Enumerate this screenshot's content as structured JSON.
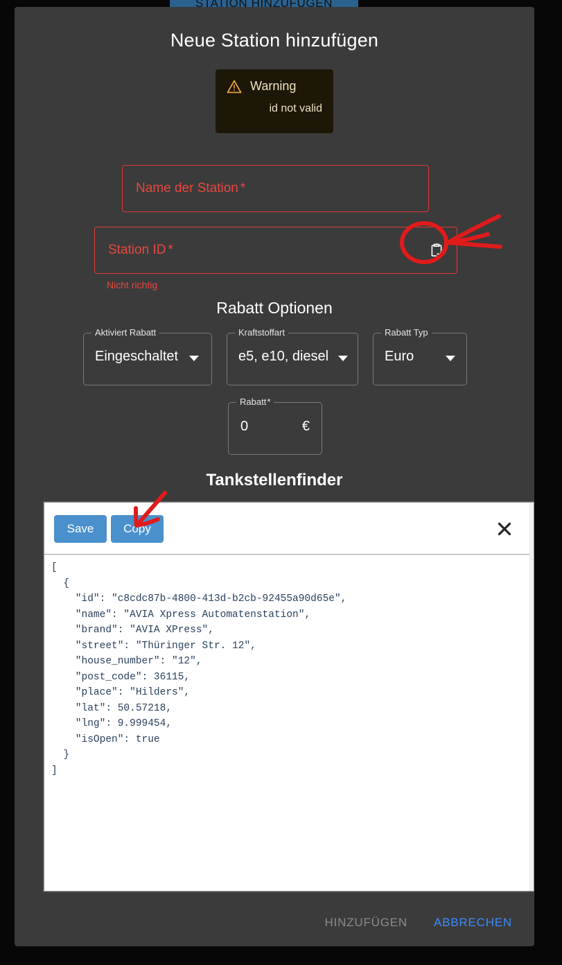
{
  "top_button": {
    "label": "STATION HINZUFÜGEN"
  },
  "dialog": {
    "title": "Neue Station hinzufügen",
    "warning": {
      "icon": "warning-triangle-icon",
      "title": "Warning",
      "message": "id not valid"
    },
    "fields": {
      "name": {
        "label": "Name der Station",
        "required_marker": "*",
        "value": ""
      },
      "station_id": {
        "label": "Station ID",
        "required_marker": "*",
        "value": "",
        "error": "Nicht richtig",
        "action_icon": "clipboard-export-icon"
      }
    },
    "discount_section": {
      "heading": "Rabatt Optionen",
      "selects": [
        {
          "legend": "Aktiviert Rabatt",
          "value": "Eingeschaltet"
        },
        {
          "legend": "Kraftstoffart",
          "value": "e5, e10, diesel"
        },
        {
          "legend": "Rabatt Typ",
          "value": "Euro"
        }
      ],
      "amount": {
        "legend": "Rabatt",
        "required_marker": "*",
        "value": "0",
        "suffix": "€"
      }
    },
    "finder_section": {
      "heading": "Tankstellenfinder",
      "toolbar": {
        "save_label": "Save",
        "copy_label": "Copy",
        "close_icon": "close-x-icon"
      },
      "json_output": "[\n  {\n    \"id\": \"c8cdc87b-4800-413d-b2cb-92455a90d65e\",\n    \"name\": \"AVIA Xpress Automatenstation\",\n    \"brand\": \"AVIA XPress\",\n    \"street\": \"Thüringer Str. 12\",\n    \"house_number\": \"12\",\n    \"post_code\": 36115,\n    \"place\": \"Hilders\",\n    \"lat\": 50.57218,\n    \"lng\": 9.999454,\n    \"isOpen\": true\n  }\n]"
    },
    "actions": {
      "submit_label": "HINZUFÜGEN",
      "cancel_label": "ABBRECHEN"
    }
  },
  "colors": {
    "page_background": "#070707",
    "dialog_background": "#3b3b3b",
    "error": "#e8473f",
    "accent_blue": "#3d8bfd",
    "button_blue": "#4a90cd",
    "warning_background": "#1d1708",
    "warning_text": "#f0e2c0",
    "annotation_red": "#e01b1b",
    "json_text": "#29405c"
  },
  "annotations": {
    "clipboard_highlight": "red-ellipse-around-clipboard-icon",
    "clipboard_arrow": "red-arrow-pointing-to-clipboard-icon",
    "copy_arrow": "red-arrow-pointing-to-copy-button"
  }
}
